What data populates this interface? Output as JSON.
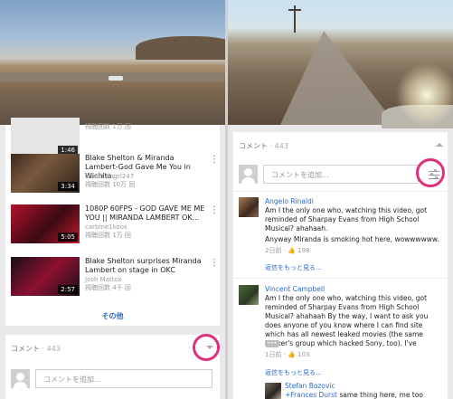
{
  "left": {
    "videos": [
      {
        "title": "",
        "channel": "",
        "views": "視聴回数 1万 回",
        "duration": "1:46"
      },
      {
        "title": "Blake Shelton & Miranda Lambert-God Gave Me You in Wichita.",
        "channel": "smalltwngrl247",
        "views": "視聴回数 10万 回",
        "duration": "3:34"
      },
      {
        "title": "1080P 60FPS - GOD GAVE ME ME YOU || MIRANDA LAMBERT OK...",
        "channel": "carbine1koos",
        "views": "視聴回数 1万 回",
        "duration": "5:05"
      },
      {
        "title": "Blake Shelton surprises Miranda Lambert on stage in OKC",
        "channel": "Josh Mattox",
        "views": "視聴回数 4千 回",
        "duration": "2:57"
      }
    ],
    "more_label": "その他",
    "comments_header": "コメント",
    "comments_count": "· 443",
    "add_comment_placeholder": "コメントを追加..."
  },
  "right": {
    "comments_header": "コメント",
    "comments_count": "· 443",
    "add_comment_placeholder": "コメントを追加...",
    "comments": [
      {
        "author": "Angelo Rinaldi",
        "text1": "Am I the only one who, watching this video, got reminded of Sharpay Evans from High School Musical? ahahaah.",
        "text2": "Anyway Miranda is smoking hot here, wowwwwww.",
        "meta_time": "2日前",
        "meta_likes": "198",
        "reply_link": "返信をもっと見る..."
      },
      {
        "author": "Vincent Campbell",
        "text1": "Am I the only one who, watching this video, got reminded of Sharpay Evans from High School Musical? ahahaah By the way, I want to ask you does anyone of you know where I can find site which has all newest leaked movies (the same hacker's group which hacked Sony, too). I've",
        "more_label": "•••",
        "meta_time": "1日前",
        "meta_likes": "103",
        "reply_link": "返信をもっと見る..."
      }
    ],
    "reply": {
      "author": "Stefan Bozovic",
      "mention": "+Frances Durst",
      "text": " same thing here, me too"
    }
  },
  "colors": {
    "accent": "#2b6cc4",
    "highlight_ring": "#e0307a"
  }
}
